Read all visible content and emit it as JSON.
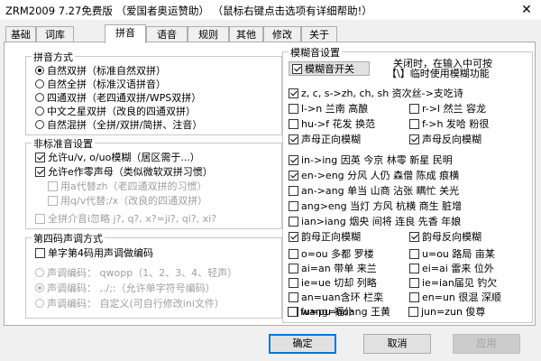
{
  "window": {
    "title": "ZRM2009 7.27免费版 （爱国者奥运赞助）  （鼠标右键点击选项有详细帮助!）",
    "close_glyph": "✕"
  },
  "tabs": [
    {
      "label": "基础",
      "active": false
    },
    {
      "label": "词库",
      "active": false
    },
    {
      "label": "拼音",
      "active": true
    },
    {
      "label": "语音",
      "active": false
    },
    {
      "label": "规则",
      "active": false
    },
    {
      "label": "其他",
      "active": false
    },
    {
      "label": "修改",
      "active": false
    },
    {
      "label": "关于",
      "active": false
    }
  ],
  "pinyin_mode": {
    "title": "拼音方式",
    "options": [
      {
        "label": "自然双拼（标准自然双拼）",
        "checked": true
      },
      {
        "label": "自然全拼（标准汉语拼音）",
        "checked": false
      },
      {
        "label": "四通双拼（老四通双拼/WPS双拼）",
        "checked": false
      },
      {
        "label": "中文之星双拼（改良的四通双拼）",
        "checked": false
      },
      {
        "label": "自然混拼（全拼/双拼/简拼、注音）",
        "checked": false
      }
    ]
  },
  "nonstandard": {
    "title": "非标准音设置",
    "items": [
      {
        "label": "允许u/v, o/uo模糊（居区需于...）",
        "checked": true,
        "enabled": true
      },
      {
        "label": "允许e作零声母（类似微软双拼习惯）",
        "checked": true,
        "enabled": true
      },
      {
        "label": "用a代替zh（老四通双拼的习惯）",
        "checked": false,
        "enabled": false
      },
      {
        "label": "用q/v代替;/x（改良的四通双拼）",
        "checked": false,
        "enabled": false
      },
      {
        "label": "全拼介音i忽略 j?, q?, x?=ji?, qi?, xi?",
        "checked": false,
        "enabled": false
      }
    ]
  },
  "fourth_code": {
    "title": "第四码声调方式",
    "checkbox": {
      "label": "单字第4码用声调做编码",
      "checked": false
    },
    "options": [
      {
        "label": "声调编码：  qwopp（1、2、3、4、轻声）",
        "checked": false
      },
      {
        "label": "声调编码：  ,./;:（允许单字符号编码）",
        "checked": true
      },
      {
        "label": "声调编码：  自定义(可自行修改ini文件）",
        "checked": false
      }
    ]
  },
  "fuzzy": {
    "title": "模糊音设置",
    "switch_label": "模糊音开关",
    "switch_checked": true,
    "note1": "关闭时，在输入中可按",
    "note2": "【\\】临时使用模糊功能",
    "initials": [
      {
        "label": "z, c, s->zh, ch, sh   资次丝->支吃诗",
        "checked": true,
        "wide": true
      },
      {
        "label": "l->n  兰南 高酿",
        "checked": false
      },
      {
        "label": "r->l  然兰 容龙",
        "checked": false
      },
      {
        "label": "hu->f 花发 换范",
        "checked": false
      },
      {
        "label": "f->h  发哈 粉很",
        "checked": false
      },
      {
        "label": "声母正向模糊",
        "checked": true
      },
      {
        "label": "声母反向模糊",
        "checked": true
      }
    ],
    "finals": [
      {
        "label": "in->ing  因英 今京 林零 新星 民明",
        "checked": true,
        "wide": true
      },
      {
        "label": "en->eng  分风 人仍 森僧 陈成 痕横",
        "checked": true,
        "wide": true
      },
      {
        "label": "an->ang  单当 山商 沾张 瞒忙 关光",
        "checked": false,
        "wide": true
      },
      {
        "label": "ang>eng  当灯 方风 杭横 商生 脏增",
        "checked": false,
        "wide": true
      },
      {
        "label": "ian>iang 烟央 间将 连良 先香 年娘",
        "checked": false,
        "wide": true
      },
      {
        "label": "韵母正向模糊",
        "checked": true
      },
      {
        "label": "韵母反向模糊",
        "checked": true
      }
    ],
    "other": [
      {
        "label": "o=ou  多都 罗楼",
        "checked": false
      },
      {
        "label": "u=ou  路局 亩某",
        "checked": false
      },
      {
        "label": "ai=an 带单 来兰",
        "checked": false
      },
      {
        "label": "ei=ai 雷来 位外",
        "checked": false
      },
      {
        "label": "ie=ue 切却 列略",
        "checked": false
      },
      {
        "label": "ie=ian届见 钓欠",
        "checked": false
      },
      {
        "label": "an=uan含环 栏栾",
        "checked": false
      },
      {
        "label": "en=un 很混 深顺",
        "checked": false
      },
      {
        "label": "wang=huang 王黄",
        "checked": false
      },
      {
        "label": "fu=pu  福仆",
        "checked": false
      },
      {
        "label": "jun=zun 俊尊",
        "checked": false
      }
    ]
  },
  "buttons": {
    "ok": "确定",
    "cancel": "取消",
    "apply": "应用"
  }
}
